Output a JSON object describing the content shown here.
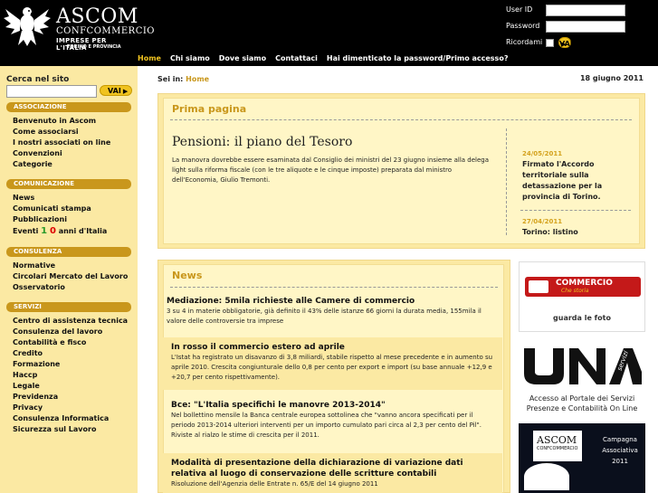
{
  "header": {
    "brand": "ASCOM",
    "brand_sub": "CONFCOMMERCIO",
    "brand_tag": "IMPRESE PER L'ITALIA",
    "brand_region": "TORINO E PROVINCIA"
  },
  "login": {
    "user_label": "User ID",
    "password_label": "Password",
    "remember_label": "Ricordami",
    "submit_label": "VAI"
  },
  "nav": {
    "items": [
      "Home",
      "Chi siamo",
      "Dove siamo",
      "Contattaci",
      "Hai dimenticato la password/Primo accesso?"
    ]
  },
  "sidebar": {
    "search_label": "Cerca nel sito",
    "search_button": "VAI",
    "sections": [
      {
        "title": "ASSOCIAZIONE",
        "items": [
          "Benvenuto in Ascom",
          "Come associarsi",
          "I nostri associati on line",
          "Convenzioni",
          "Categorie"
        ]
      },
      {
        "title": "COMUNICAZIONE",
        "items": [
          "News",
          "Comunicati stampa",
          "Pubblicazioni"
        ],
        "eventi": {
          "pre": "Eventi",
          "a": "1",
          "b": "0",
          "post": "anni d'Italia"
        }
      },
      {
        "title": "CONSULENZA",
        "items": [
          "Normative",
          "Circolari Mercato del Lavoro",
          "Osservatorio"
        ]
      },
      {
        "title": "SERVIZI",
        "items": [
          "Centro di assistenza tecnica",
          "Consulenza del lavoro",
          "Contabilità e fisco",
          "Credito",
          "Formazione",
          "Haccp",
          "Legale",
          "Previdenza",
          "Privacy",
          "Consulenza Informatica",
          "Sicurezza sul Lavoro"
        ]
      }
    ]
  },
  "breadcrumb": {
    "prefix": "Sei in:",
    "current": "Home"
  },
  "date": "18 giugno 2011",
  "prima_pagina": {
    "title": "Prima pagina",
    "headline": "Pensioni: il piano del Tesoro",
    "text": "La manovra dovrebbe essere esaminata dal Consiglio dei ministri del 23 giugno insieme alla delega light sulla riforma fiscale (con le tre aliquote e le cinque imposte) preparata dal ministro dell'Economia, Giulio Tremonti.",
    "side_news": [
      {
        "date": "24/05/2011",
        "title": "Firmato l'Accordo territoriale sulla detassazione per la provincia di Torino."
      },
      {
        "date": "27/04/2011",
        "title": "Torino: listino"
      }
    ]
  },
  "news": {
    "title": "News",
    "items": [
      {
        "headline": "Mediazione: 5mila richieste alle Camere di commercio",
        "text": "3 su 4 in materie obbligatorie, già definito il 43% delle istanze 66 giorni la durata media, 155mila il valore delle controversie tra imprese"
      },
      {
        "headline": "In rosso il commercio estero ad aprile",
        "text": "L'Istat ha registrato un disavanzo di 3,8 miliardi, stabile rispetto al mese precedente e in aumento su aprile 2010. Crescita congiunturale dello 0,8 per cento per export e import (su base annuale +12,9 e +20,7 per cento rispettivamente)."
      },
      {
        "headline": "Bce: \"L'Italia specifichi le manovre 2013-2014\"",
        "text": "Nel bollettino mensile la Banca centrale europea sottolinea che \"vanno ancora specificati per il periodo 2013-2014 ulteriori interventi per un importo cumulato pari circa al 2,3 per cento del Pil\". Riviste al rialzo le stime di crescita per il 2011."
      },
      {
        "headline": "Modalità di presentazione della dichiarazione di variazione dati relativa al luogo di conservazione delle scritture contabili",
        "text": "Risoluzione dell'Agenzia delle Entrate n. 65/E del 14 giugno 2011"
      }
    ]
  },
  "banners": [
    {
      "logo": "COMMERCIO",
      "sub": "Che storia",
      "caption": "guarda le foto"
    },
    {
      "logo": "UNA",
      "logo_sub": "servizi",
      "caption": "Accesso al Portale dei Servizi Presenze e Contabilità On Line"
    },
    {
      "logo": "ASCOM",
      "logo_sub": "CONFCOMMERCIO",
      "text1": "Campagna",
      "text2": "Associativa",
      "text3": "2011"
    }
  ],
  "colors": {
    "accent": "#c9971c",
    "sidebar_bg": "#fbe9a3",
    "header_bg": "#000000",
    "nav_active": "#f0c320"
  }
}
